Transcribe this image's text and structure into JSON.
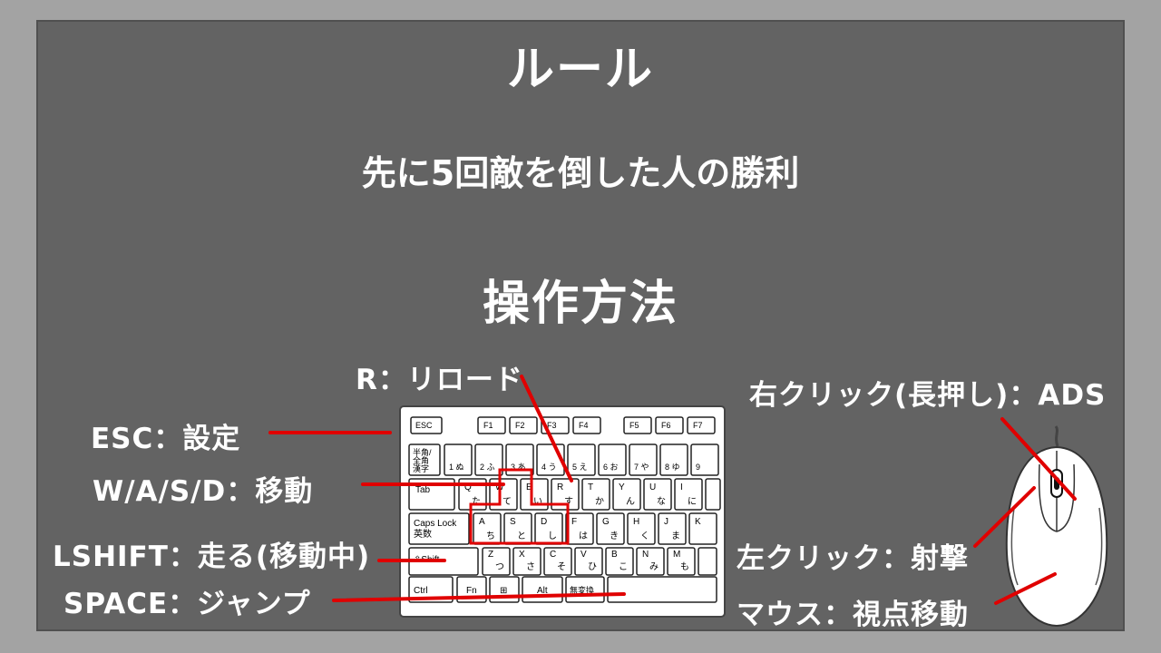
{
  "title": "ルール",
  "rule": "先に5回敵を倒した人の勝利",
  "controls_heading": "操作方法",
  "labels": {
    "reload": "R：リロード",
    "esc": "ESC：設定",
    "move": "W/A/S/D：移動",
    "shift": "LSHIFT：走る(移動中)",
    "jump": "SPACE：ジャンプ",
    "ads": "右クリック(長押し)：ADS",
    "shoot": "左クリック：射撃",
    "look": "マウス：視点移動"
  },
  "keyboard": {
    "fn_row": [
      "ESC",
      "F1",
      "F2",
      "F3",
      "F4",
      "F5",
      "F6",
      "F7"
    ],
    "num_row": [
      "半角/全角漢字",
      "1 ぬ",
      "2 ふ",
      "3 あ",
      "4 う",
      "5 え",
      "6 お",
      "7 や",
      "8 ゆ",
      "9"
    ],
    "top_row": [
      "Tab",
      "Q た",
      "W て",
      "E い",
      "R す",
      "T か",
      "Y ん",
      "U な",
      "I に"
    ],
    "home_row": [
      "Caps Lock 英数",
      "A ち",
      "S と",
      "D し",
      "F は",
      "G き",
      "H く",
      "J ま",
      "K"
    ],
    "shift_row": [
      "⇧Shift",
      "Z つ",
      "X さ",
      "C そ",
      "V ひ",
      "B こ",
      "N み",
      "M も"
    ],
    "bottom_row": [
      "Ctrl",
      "Fn",
      "⊞",
      "Alt",
      "無変換"
    ]
  },
  "colors": {
    "background": "#a3a3a3",
    "panel": "#636363",
    "text": "#ffffff",
    "leader": "#e00000",
    "highlight": "#e00000"
  }
}
